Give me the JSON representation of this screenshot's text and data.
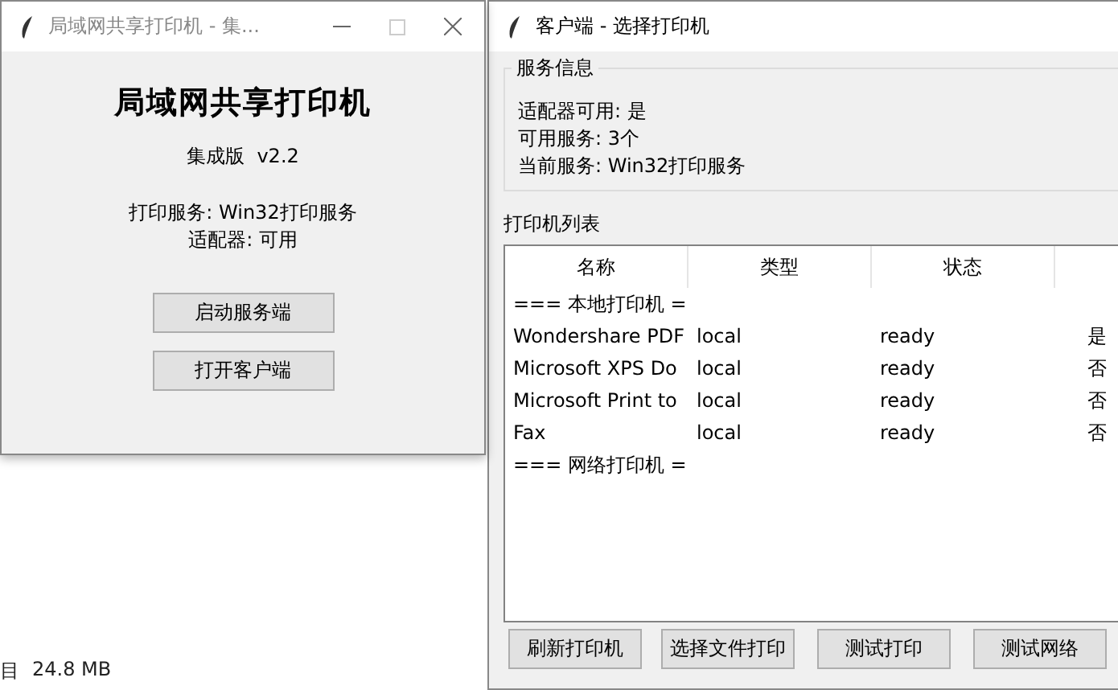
{
  "background": {
    "status_text": "目",
    "size_text": "24.8 MB"
  },
  "server_window": {
    "title": "局域网共享打印机 - 集...",
    "heading": "局域网共享打印机",
    "edition": "集成版  v2.2",
    "info_lines": [
      "打印服务: Win32打印服务",
      "适配器: 可用"
    ],
    "buttons": [
      "启动服务端",
      "打开客户端"
    ]
  },
  "client_window": {
    "title": "客户端 - 选择打印机",
    "service_info": {
      "title": "服务信息",
      "lines": [
        "适配器可用: 是",
        "可用服务: 3个",
        "当前服务: Win32打印服务"
      ]
    },
    "printer_list": {
      "title": "打印机列表",
      "columns": [
        "名称",
        "类型",
        "状态"
      ],
      "rows": [
        {
          "kind": "group",
          "label": "=== 本地打印机 ="
        },
        {
          "kind": "printer",
          "cells": [
            "Wondershare PDF",
            "local",
            "ready",
            "是"
          ]
        },
        {
          "kind": "printer",
          "cells": [
            "Microsoft XPS Do",
            "local",
            "ready",
            "否"
          ]
        },
        {
          "kind": "printer",
          "cells": [
            "Microsoft Print to",
            "local",
            "ready",
            "否"
          ]
        },
        {
          "kind": "printer",
          "cells": [
            "Fax",
            "local",
            "ready",
            "否"
          ]
        },
        {
          "kind": "group",
          "label": "=== 网络打印机 ="
        }
      ]
    },
    "buttons": [
      "刷新打印机",
      "选择文件打印",
      "测试打印",
      "测试网络"
    ]
  }
}
